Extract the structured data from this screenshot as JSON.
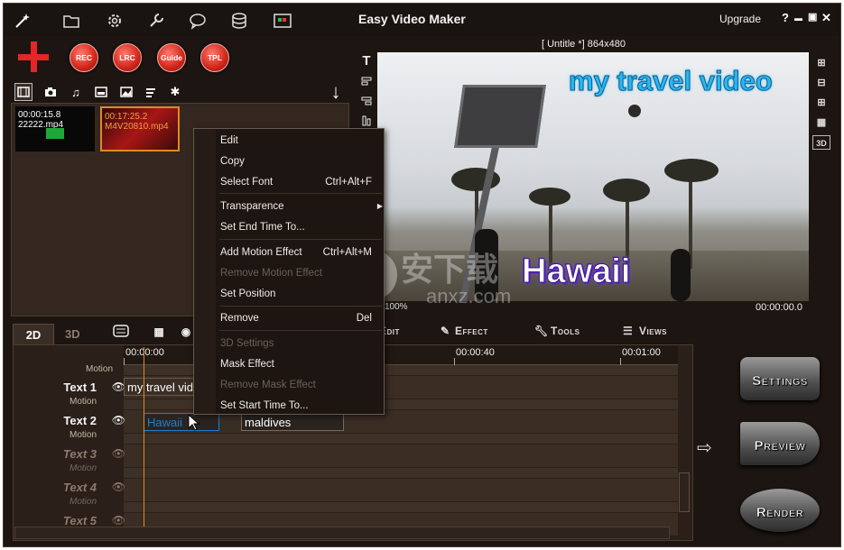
{
  "app": {
    "title": "Easy Video Maker",
    "upgrade_label": "Upgrade",
    "help_label": "?",
    "minimize_label": "▬",
    "maximize_label": "▣",
    "close_label": "✕"
  },
  "toolbar": {
    "buttons": [
      "REC",
      "LRC",
      "Guide",
      "TPL"
    ]
  },
  "media": {
    "clips": [
      {
        "time": "00:00:15.8",
        "name": "22222.mp4"
      },
      {
        "time": "00:17:25.2",
        "name": "M4V20810.mp4"
      }
    ]
  },
  "preview": {
    "caption": "[ Untitle *]   864x480",
    "title_text": "my travel video",
    "overlay_text": "Hawaii",
    "time": "00:00:00.0",
    "zoom": "100%"
  },
  "timeline_tabs": {
    "tab_2d": "2D",
    "tab_3d": "3D"
  },
  "edit_tools": {
    "edit": "Edit",
    "effect": "Effect",
    "tools": "Tools",
    "views": "Views"
  },
  "timeline": {
    "ticks": [
      "00:00:00",
      "00:00:40",
      "00:01:00"
    ],
    "top_motion": "Motion",
    "tracks": [
      {
        "name": "Text 1",
        "motion": "Motion",
        "active": true
      },
      {
        "name": "Text 2",
        "motion": "Motion",
        "active": true
      },
      {
        "name": "Text 3",
        "motion": "Motion",
        "active": false
      },
      {
        "name": "Text 4",
        "motion": "Motion",
        "active": false
      },
      {
        "name": "Text 5",
        "motion": "",
        "active": false
      }
    ],
    "clips": {
      "text1": "my travel vid",
      "text2_a": "Hawaii",
      "text2_b": "maldives"
    }
  },
  "big_buttons": {
    "settings": "Settings",
    "preview": "Preview",
    "render": "Render"
  },
  "context_menu": {
    "items": [
      {
        "label": "Edit",
        "shortcut": "",
        "disabled": false
      },
      {
        "label": "Copy",
        "shortcut": "",
        "disabled": false
      },
      {
        "label": "Select Font",
        "shortcut": "Ctrl+Alt+F",
        "disabled": false
      },
      {
        "label": "Transparence",
        "shortcut": "",
        "disabled": false
      },
      {
        "label": "Set End Time To...",
        "shortcut": "",
        "disabled": false
      },
      {
        "label": "Add Motion Effect",
        "shortcut": "Ctrl+Alt+M",
        "disabled": false
      },
      {
        "label": "Remove Motion Effect",
        "shortcut": "",
        "disabled": true
      },
      {
        "label": "Set Position",
        "shortcut": "",
        "disabled": false
      },
      {
        "label": "Remove",
        "shortcut": "Del",
        "disabled": false
      },
      {
        "label": "3D Settings",
        "shortcut": "",
        "disabled": true
      },
      {
        "label": "Mask Effect",
        "shortcut": "",
        "disabled": false
      },
      {
        "label": "Remove Mask Effect",
        "shortcut": "",
        "disabled": true
      },
      {
        "label": "Set Start Time To...",
        "shortcut": "",
        "disabled": false
      }
    ]
  },
  "colors": {
    "background": "#1c1511",
    "panel": "#33271f",
    "accent_orange": "#e08a22",
    "record_red": "#d0251b",
    "title_blue": "#28b8ee",
    "clip_blue": "#1b7fd8"
  }
}
